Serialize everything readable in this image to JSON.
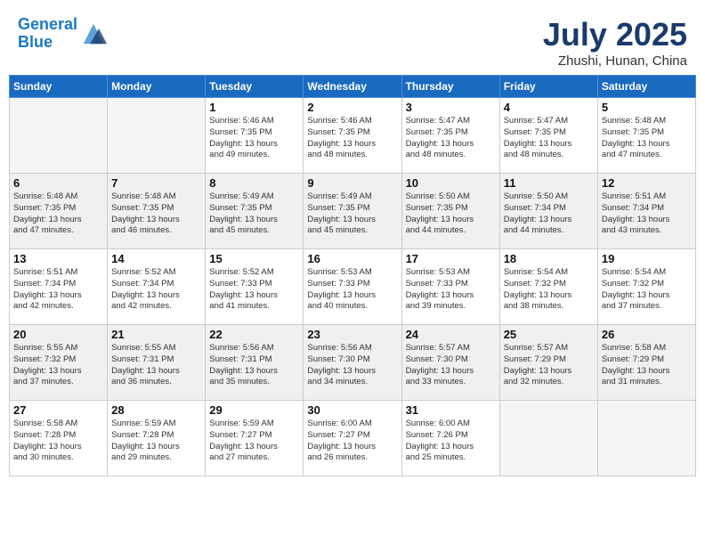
{
  "header": {
    "logo_line1": "General",
    "logo_line2": "Blue",
    "month_year": "July 2025",
    "location": "Zhushi, Hunan, China"
  },
  "days_of_week": [
    "Sunday",
    "Monday",
    "Tuesday",
    "Wednesday",
    "Thursday",
    "Friday",
    "Saturday"
  ],
  "weeks": [
    [
      {
        "day": "",
        "info": ""
      },
      {
        "day": "",
        "info": ""
      },
      {
        "day": "1",
        "info": "Sunrise: 5:46 AM\nSunset: 7:35 PM\nDaylight: 13 hours\nand 49 minutes."
      },
      {
        "day": "2",
        "info": "Sunrise: 5:46 AM\nSunset: 7:35 PM\nDaylight: 13 hours\nand 48 minutes."
      },
      {
        "day": "3",
        "info": "Sunrise: 5:47 AM\nSunset: 7:35 PM\nDaylight: 13 hours\nand 48 minutes."
      },
      {
        "day": "4",
        "info": "Sunrise: 5:47 AM\nSunset: 7:35 PM\nDaylight: 13 hours\nand 48 minutes."
      },
      {
        "day": "5",
        "info": "Sunrise: 5:48 AM\nSunset: 7:35 PM\nDaylight: 13 hours\nand 47 minutes."
      }
    ],
    [
      {
        "day": "6",
        "info": "Sunrise: 5:48 AM\nSunset: 7:35 PM\nDaylight: 13 hours\nand 47 minutes."
      },
      {
        "day": "7",
        "info": "Sunrise: 5:48 AM\nSunset: 7:35 PM\nDaylight: 13 hours\nand 46 minutes."
      },
      {
        "day": "8",
        "info": "Sunrise: 5:49 AM\nSunset: 7:35 PM\nDaylight: 13 hours\nand 45 minutes."
      },
      {
        "day": "9",
        "info": "Sunrise: 5:49 AM\nSunset: 7:35 PM\nDaylight: 13 hours\nand 45 minutes."
      },
      {
        "day": "10",
        "info": "Sunrise: 5:50 AM\nSunset: 7:35 PM\nDaylight: 13 hours\nand 44 minutes."
      },
      {
        "day": "11",
        "info": "Sunrise: 5:50 AM\nSunset: 7:34 PM\nDaylight: 13 hours\nand 44 minutes."
      },
      {
        "day": "12",
        "info": "Sunrise: 5:51 AM\nSunset: 7:34 PM\nDaylight: 13 hours\nand 43 minutes."
      }
    ],
    [
      {
        "day": "13",
        "info": "Sunrise: 5:51 AM\nSunset: 7:34 PM\nDaylight: 13 hours\nand 42 minutes."
      },
      {
        "day": "14",
        "info": "Sunrise: 5:52 AM\nSunset: 7:34 PM\nDaylight: 13 hours\nand 42 minutes."
      },
      {
        "day": "15",
        "info": "Sunrise: 5:52 AM\nSunset: 7:33 PM\nDaylight: 13 hours\nand 41 minutes."
      },
      {
        "day": "16",
        "info": "Sunrise: 5:53 AM\nSunset: 7:33 PM\nDaylight: 13 hours\nand 40 minutes."
      },
      {
        "day": "17",
        "info": "Sunrise: 5:53 AM\nSunset: 7:33 PM\nDaylight: 13 hours\nand 39 minutes."
      },
      {
        "day": "18",
        "info": "Sunrise: 5:54 AM\nSunset: 7:32 PM\nDaylight: 13 hours\nand 38 minutes."
      },
      {
        "day": "19",
        "info": "Sunrise: 5:54 AM\nSunset: 7:32 PM\nDaylight: 13 hours\nand 37 minutes."
      }
    ],
    [
      {
        "day": "20",
        "info": "Sunrise: 5:55 AM\nSunset: 7:32 PM\nDaylight: 13 hours\nand 37 minutes."
      },
      {
        "day": "21",
        "info": "Sunrise: 5:55 AM\nSunset: 7:31 PM\nDaylight: 13 hours\nand 36 minutes."
      },
      {
        "day": "22",
        "info": "Sunrise: 5:56 AM\nSunset: 7:31 PM\nDaylight: 13 hours\nand 35 minutes."
      },
      {
        "day": "23",
        "info": "Sunrise: 5:56 AM\nSunset: 7:30 PM\nDaylight: 13 hours\nand 34 minutes."
      },
      {
        "day": "24",
        "info": "Sunrise: 5:57 AM\nSunset: 7:30 PM\nDaylight: 13 hours\nand 33 minutes."
      },
      {
        "day": "25",
        "info": "Sunrise: 5:57 AM\nSunset: 7:29 PM\nDaylight: 13 hours\nand 32 minutes."
      },
      {
        "day": "26",
        "info": "Sunrise: 5:58 AM\nSunset: 7:29 PM\nDaylight: 13 hours\nand 31 minutes."
      }
    ],
    [
      {
        "day": "27",
        "info": "Sunrise: 5:58 AM\nSunset: 7:28 PM\nDaylight: 13 hours\nand 30 minutes."
      },
      {
        "day": "28",
        "info": "Sunrise: 5:59 AM\nSunset: 7:28 PM\nDaylight: 13 hours\nand 29 minutes."
      },
      {
        "day": "29",
        "info": "Sunrise: 5:59 AM\nSunset: 7:27 PM\nDaylight: 13 hours\nand 27 minutes."
      },
      {
        "day": "30",
        "info": "Sunrise: 6:00 AM\nSunset: 7:27 PM\nDaylight: 13 hours\nand 26 minutes."
      },
      {
        "day": "31",
        "info": "Sunrise: 6:00 AM\nSunset: 7:26 PM\nDaylight: 13 hours\nand 25 minutes."
      },
      {
        "day": "",
        "info": ""
      },
      {
        "day": "",
        "info": ""
      }
    ]
  ]
}
